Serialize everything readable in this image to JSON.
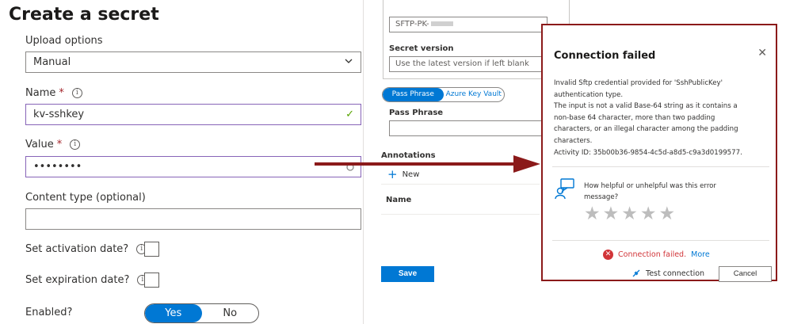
{
  "form": {
    "title": "Create a secret",
    "upload_label": "Upload options",
    "upload_value": "Manual",
    "name_label": "Name",
    "name_value": "kv-sshkey",
    "value_label": "Value",
    "value_value": "••••••••",
    "content_type_label": "Content type (optional)",
    "content_type_value": "",
    "activation_label": "Set activation date?",
    "expiration_label": "Set expiration date?",
    "enabled_label": "Enabled?",
    "enabled_yes": "Yes",
    "enabled_no": "No",
    "required_mark": "*"
  },
  "middle": {
    "top_value": "SFTP-PK-",
    "secret_version_label": "Secret version",
    "secret_version_placeholder": "Use the latest version if left blank",
    "tab_pass_phrase": "Pass Phrase",
    "tab_key_vault": "Azure Key Vault",
    "pass_phrase_label": "Pass Phrase",
    "annotations_label": "Annotations",
    "new_label": "New",
    "name_col": "Name",
    "save_label": "Save"
  },
  "dialog": {
    "title": "Connection failed",
    "message_lines": [
      "Invalid Sftp credential provided for 'SshPublicKey'",
      "authentication type.",
      "The input is not a valid Base-64 string as it contains a",
      "non-base 64 character, more than two padding",
      "characters, or an illegal character among the padding",
      "characters.",
      "Activity ID: 35b00b36-9854-4c5d-a8d5-c9a3d0199577."
    ],
    "feedback_text": "How helpful or unhelpful was this error message?",
    "star_rating": 0,
    "error_status": "Connection failed.",
    "more_link": "More",
    "test_connection": "Test connection",
    "cancel": "Cancel"
  },
  "colors": {
    "accent": "#0078d4",
    "error": "#d13438",
    "highlight_border": "#8b1a1a",
    "focus_border": "#8764b8"
  }
}
